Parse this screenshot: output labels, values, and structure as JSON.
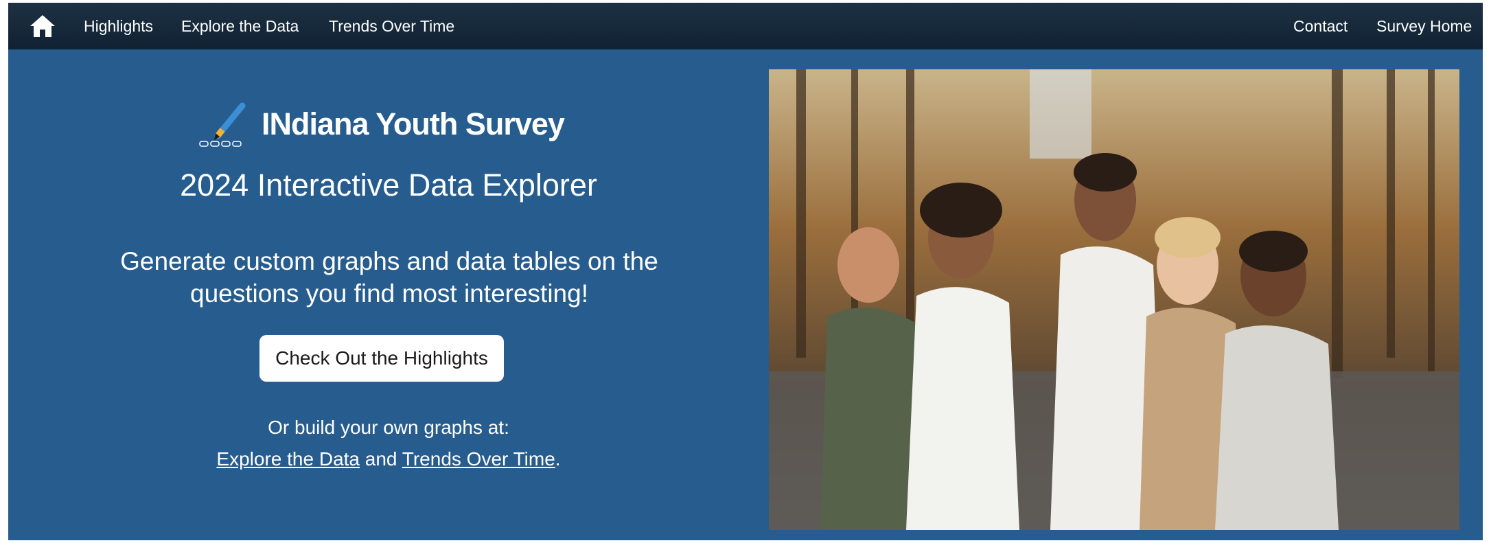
{
  "nav": {
    "home_icon": "home-icon",
    "links": [
      "Highlights",
      "Explore the Data",
      "Trends Over Time"
    ],
    "right_links": [
      "Contact",
      "Survey Home"
    ]
  },
  "hero": {
    "logo_icon": "pencil-survey-icon",
    "logo_text": "INdiana Youth Survey",
    "subtitle": "2024 Interactive Data Explorer",
    "tagline": "Generate custom graphs and data tables on the questions you find most interesting!",
    "cta_label": "Check Out the Highlights",
    "build_prefix": "Or build your own graphs at:",
    "build_link1": "Explore the Data",
    "build_and": " and ",
    "build_link2": "Trends Over Time",
    "build_period": "."
  },
  "photo": {
    "subject": "five smiling teenagers embracing in an autumn park"
  },
  "colors": {
    "navbar": "#13263a",
    "hero_bg": "#275d8e",
    "text": "#ffffff",
    "button_bg": "#ffffff"
  }
}
